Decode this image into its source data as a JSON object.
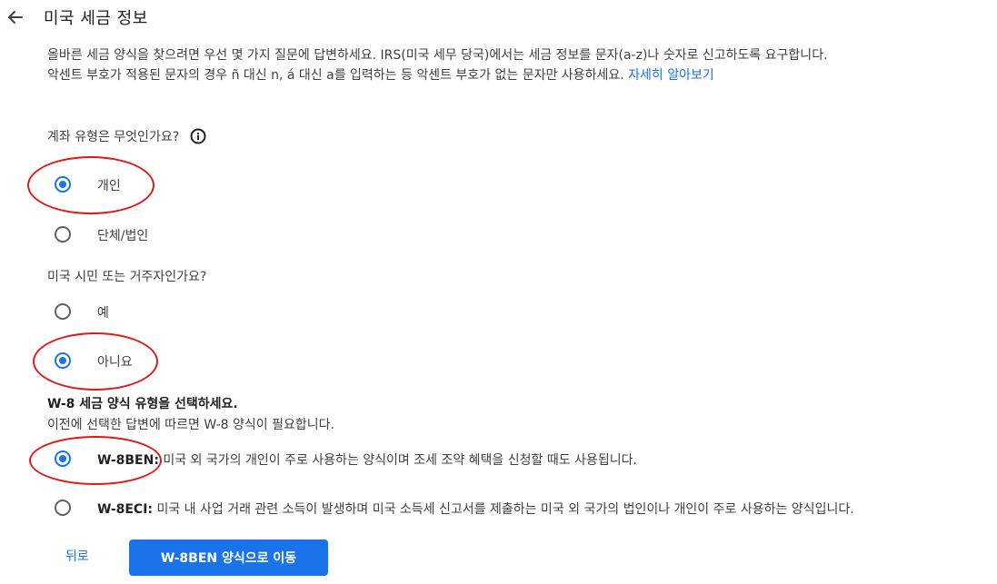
{
  "header": {
    "back_icon": "arrow-left-icon",
    "title": "미국 세금 정보"
  },
  "intro": {
    "line1": "올바른 세금 양식을 찾으려면 우선 몇 가지 질문에 답변하세요. IRS(미국 세무 당국)에서는 세금 정보를 문자(a-z)나 숫자로 신고하도록 요구합니다.",
    "line2": "악센트 부호가 적용된 문자의 경우 ñ 대신 n, á 대신 a를 입력하는 등 악센트 부호가 없는 문자만 사용하세요.",
    "learn_more": "자세히 알아보기"
  },
  "account_type": {
    "question": "계좌 유형은 무엇인가요?",
    "info_icon": "info-icon",
    "options": [
      {
        "label": "개인",
        "selected": true
      },
      {
        "label": "단체/법인",
        "selected": false
      }
    ]
  },
  "us_person": {
    "question": "미국 시민 또는 거주자인가요?",
    "options": [
      {
        "label": "예",
        "selected": false
      },
      {
        "label": "아니요",
        "selected": true
      }
    ]
  },
  "w8": {
    "title": "W-8 세금 양식 유형을 선택하세요.",
    "subtitle": "이전에 선택한 답변에 따르면 W-8 양식이 필요합니다.",
    "options": [
      {
        "code": "W-8BEN:",
        "desc": " 미국 외 국가의 개인이 주로 사용하는 양식이며 조세 조약 혜택을 신청할 때도 사용됩니다.",
        "selected": true
      },
      {
        "code": "W-8ECI:",
        "desc": " 미국 내 사업 거래 관련 소득이 발생하며 미국 소득세 신고서를 제출하는 미국 외 국가의 법인이나 개인이 주로 사용하는 양식입니다.",
        "selected": false
      }
    ]
  },
  "footer": {
    "back_label": "뒤로",
    "primary_label": "W-8BEN 양식으로 이동"
  },
  "colors": {
    "accent": "#1a73e8",
    "annotation": "#e01919"
  }
}
